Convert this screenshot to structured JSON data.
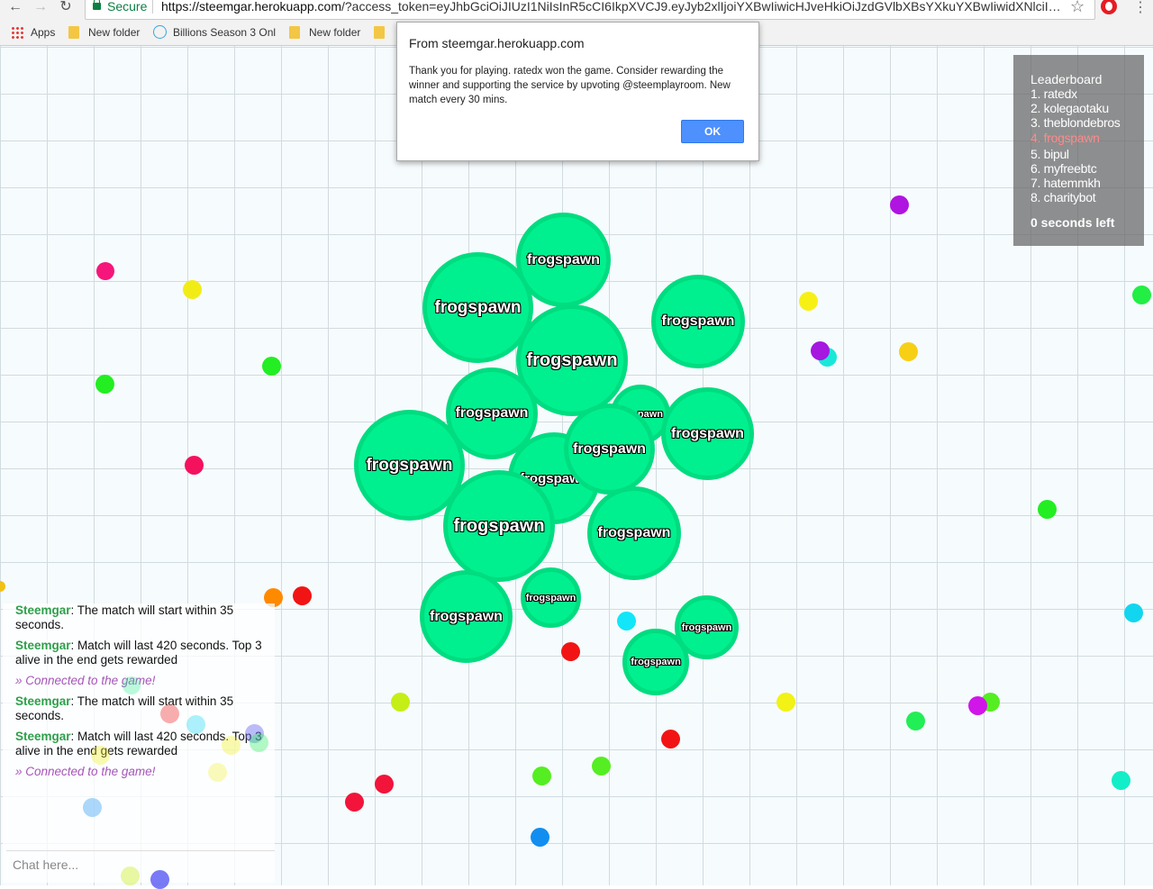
{
  "browser": {
    "secure_label": "Secure",
    "url_host": "https://steemgar.herokuapp.com",
    "url_rest": "/?access_token=eyJhbGciOiJIUzI1NiIsInR5cCI6IkpXVCJ9.eyJyb2xlIjoiYXBwIiwicHJveHkiOiJzdGVlbXBsYXkuYXBwIiwidXNlciI6ImZyb…",
    "bookmarks": [
      {
        "label": "Apps",
        "icon": "apps-grid-icon"
      },
      {
        "label": "New folder",
        "icon": "folder-icon"
      },
      {
        "label": "Billions Season 3 Onl",
        "icon": "play-circle-icon"
      },
      {
        "label": "New folder",
        "icon": "folder-icon"
      },
      {
        "label": "",
        "icon": "folder-icon"
      }
    ]
  },
  "dialog": {
    "title": "From steemgar.herokuapp.com",
    "message": "Thank you for playing. ratedx won the game. Consider rewarding the winner and supporting the service by upvoting @steemplayroom. New match every 30 mins.",
    "ok_label": "OK"
  },
  "leaderboard": {
    "title": "Leaderboard",
    "entries": [
      "1. ratedx",
      "2. kolegaotaku",
      "3. theblondebros",
      "4. frogspawn",
      "5. bipul",
      "6. myfreebtc",
      "7. hatemmkh",
      "8. charitybot"
    ],
    "highlight_index": 3,
    "timer": "0 seconds left"
  },
  "player": {
    "name": "frogspawn",
    "color": "#00f08f",
    "border_color": "#00dc80"
  },
  "chat": {
    "messages": [
      {
        "author": "Steemgar",
        "text": ": The match will start within 35 seconds."
      },
      {
        "author": "Steemgar",
        "text": ": Match will last 420 seconds. Top 3 alive in the end gets rewarded"
      },
      {
        "system": "» Connected to the game!"
      },
      {
        "author": "Steemgar",
        "text": ": The match will start within 35 seconds."
      },
      {
        "author": "Steemgar",
        "text": ": Match will last 420 seconds. Top 3 alive in the end gets rewarded"
      },
      {
        "system": "» Connected to the game!"
      }
    ],
    "placeholder": "Chat here..."
  }
}
